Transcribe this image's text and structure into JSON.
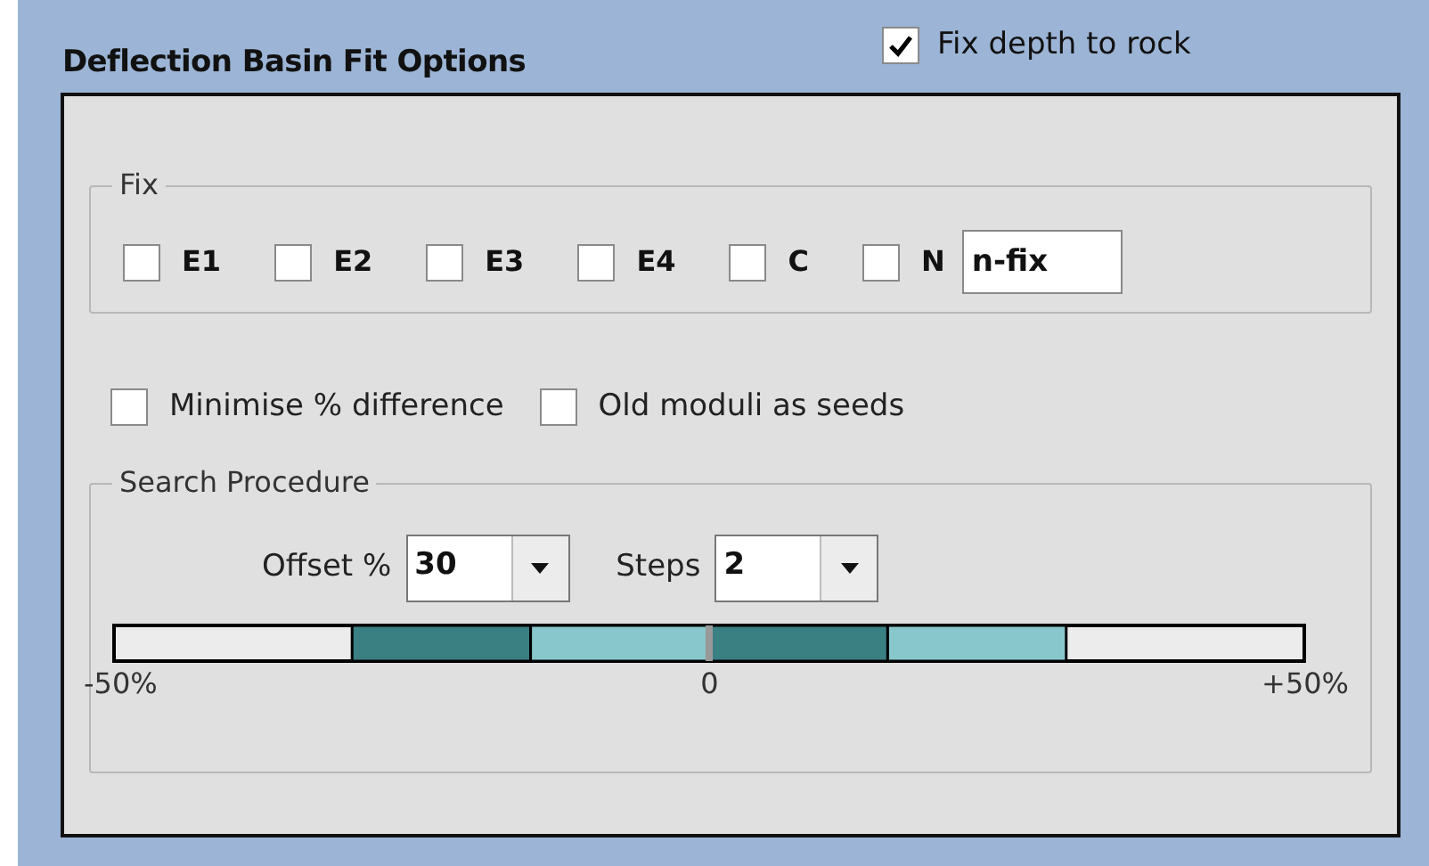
{
  "panel": {
    "title": "Deflection Basin Fit Options",
    "fix_depth": {
      "label": "Fix depth to rock",
      "checked": true
    }
  },
  "fix_group": {
    "title": "Fix",
    "items": [
      {
        "label": "E1",
        "checked": false
      },
      {
        "label": "E2",
        "checked": false
      },
      {
        "label": "E3",
        "checked": false
      },
      {
        "label": "E4",
        "checked": false
      },
      {
        "label": "C",
        "checked": false
      },
      {
        "label": "N",
        "checked": false
      }
    ],
    "n_fix": {
      "value": "n-fix"
    }
  },
  "options": [
    {
      "label": "Minimise % difference",
      "checked": false
    },
    {
      "label": "Old moduli as seeds",
      "checked": false
    }
  ],
  "search": {
    "title": "Search Procedure",
    "offset": {
      "label": "Offset %",
      "value": "30"
    },
    "steps": {
      "label": "Steps",
      "value": "2"
    },
    "scale": [
      "-50%",
      "0",
      "+50%"
    ]
  }
}
